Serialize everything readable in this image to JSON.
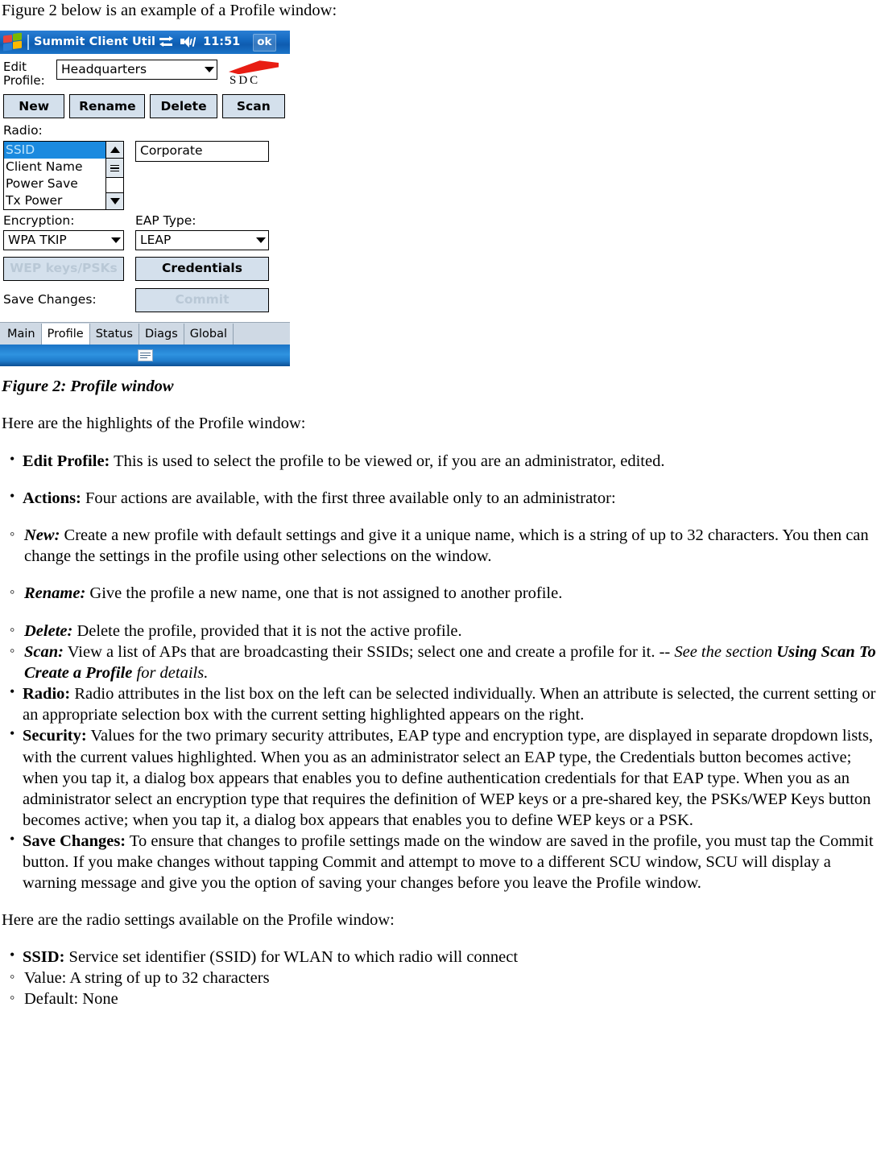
{
  "doc": {
    "intro_line": "Figure 2 below is an example of a Profile window:",
    "figure_caption": "Figure 2: Profile window",
    "highlights_lead": "Here are the highlights of the Profile window:",
    "radio_settings_lead": "Here are the radio settings available on the Profile window:"
  },
  "pda": {
    "titlebar": {
      "title": "Summit Client Util",
      "time": "11:51",
      "ok_label": "ok",
      "sync_icon": "sync-icon",
      "speaker_icon": "speaker-icon",
      "windows_flag_icon": "windows-flag-icon"
    },
    "edit_profile": {
      "label_line1": "Edit",
      "label_line2": "Profile:",
      "value": "Headquarters"
    },
    "logo": {
      "text": "SDC",
      "wedge_color": "#e81d13"
    },
    "actions": [
      {
        "label": "New",
        "disabled": false
      },
      {
        "label": "Rename",
        "disabled": false
      },
      {
        "label": "Delete",
        "disabled": false
      },
      {
        "label": "Scan",
        "disabled": false
      }
    ],
    "radio": {
      "label": "Radio:",
      "items": [
        {
          "label": "SSID",
          "selected": true
        },
        {
          "label": "Client Name",
          "selected": false
        },
        {
          "label": "Power Save",
          "selected": false
        },
        {
          "label": "Tx Power",
          "selected": false
        }
      ],
      "value": "Corporate"
    },
    "encryption": {
      "label": "Encryption:",
      "value": "WPA TKIP"
    },
    "eap": {
      "label": "EAP Type:",
      "value": "LEAP"
    },
    "wep_button": {
      "label": "WEP keys/PSKs",
      "disabled": true
    },
    "credentials_button": {
      "label": "Credentials",
      "disabled": false
    },
    "save_changes": {
      "label": "Save Changes:",
      "commit_label": "Commit",
      "commit_disabled": true
    },
    "tabs": [
      {
        "label": "Main",
        "active": false
      },
      {
        "label": "Profile",
        "active": true
      },
      {
        "label": "Status",
        "active": false
      },
      {
        "label": "Diags",
        "active": false
      },
      {
        "label": "Global",
        "active": false
      }
    ],
    "taskbar": {
      "sip_icon": "keyboard-icon"
    },
    "colors": {
      "title_blue": "#1469c0",
      "selection_blue": "#1b8adf",
      "button_face": "#d4e0ec",
      "tab_face": "#cfd9e4"
    }
  },
  "highlights": {
    "edit_profile": {
      "term": "Edit Profile:",
      "text": " This is used to select the profile to be viewed or, if you are an administrator, edited."
    },
    "actions": {
      "term": "Actions:",
      "text": " Four actions are available, with the first three available only to an administrator:"
    },
    "sub_actions": {
      "new": {
        "term": "New:",
        "text": " Create a new profile with default settings and give it a unique name, which is a string of up to 32 characters. You then can change the settings in the profile using other selections on the window."
      },
      "rename": {
        "term": "Rename:",
        "text": " Give the profile a new name, one that is not assigned to another profile."
      },
      "delete": {
        "term": "Delete:",
        "text": " Delete the profile, provided that it is not the active profile."
      },
      "scan": {
        "term": "Scan:",
        "text": " View a list of APs that are broadcasting their SSIDs; select one and create a profile for it. -- ",
        "note_pre": "See the section ",
        "note_bold": "Using Scan To Create a Profile",
        "note_post": " for details."
      }
    },
    "radio": {
      "term": "Radio:",
      "text": " Radio attributes in the list box on the left can be selected individually. When an attribute is selected, the current setting or an appropriate selection box with the current setting highlighted appears on the right."
    },
    "security": {
      "term": "Security:",
      "text": " Values for the two primary security attributes, EAP type and encryption type, are displayed in separate dropdown lists, with the current values highlighted. When you as an administrator select an EAP type, the Credentials button becomes active; when you tap it, a dialog box appears that enables you to define authentication credentials for that EAP type. When you as an administrator select an encryption type that requires the definition of WEP keys or a pre-shared key, the PSKs/WEP Keys button becomes active; when you tap it, a dialog box appears that enables you to define WEP keys or a PSK."
    },
    "save_changes": {
      "term": "Save Changes:",
      "text": " To ensure that changes to profile settings made on the window are saved in the profile, you must tap the Commit button. If you make changes without tapping Commit and attempt to move to a different SCU window, SCU will display a warning message and give you the option of saving your changes before you leave the Profile window."
    }
  },
  "radio_settings": {
    "ssid": {
      "term": "SSID:",
      "text": " Service set identifier (SSID) for WLAN to which radio will connect",
      "value_line": "Value: A string of up to 32 characters",
      "default_line": "Default: None"
    }
  }
}
